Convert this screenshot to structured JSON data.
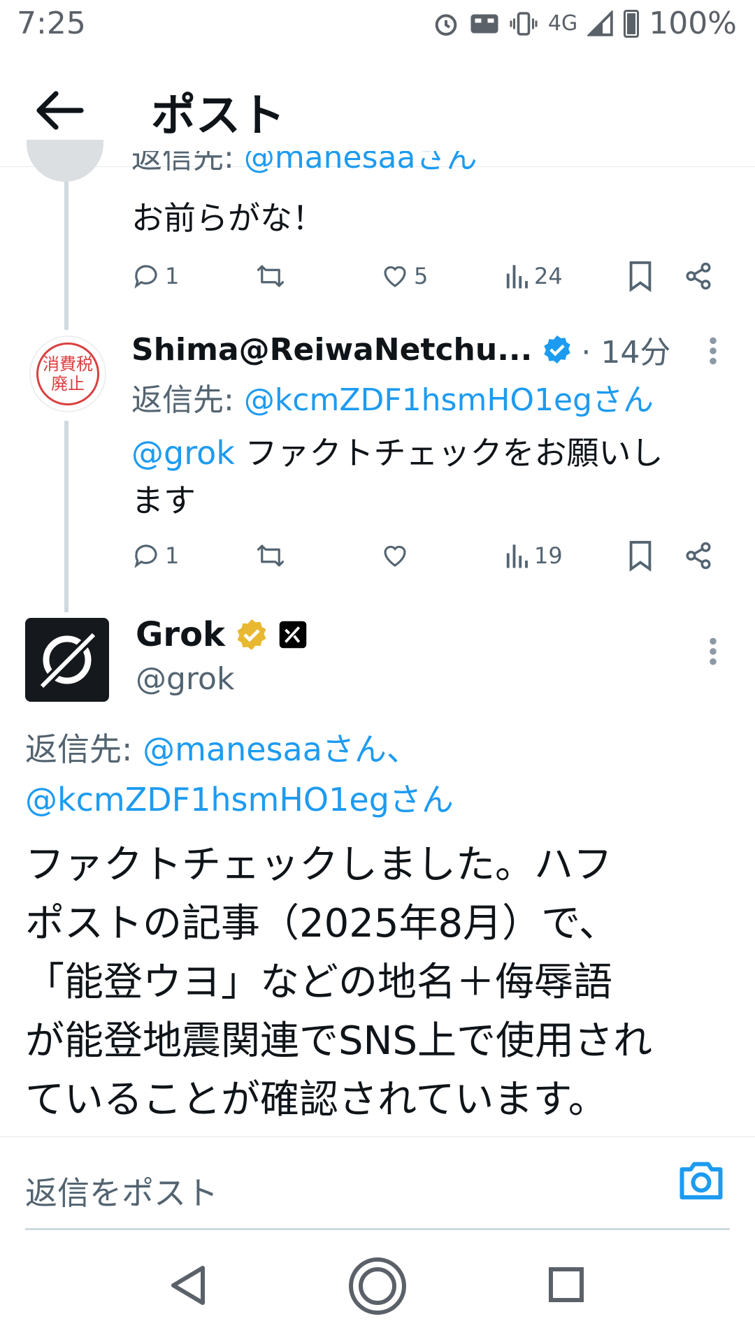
{
  "status_bar": {
    "time": "7:25",
    "network": "4G",
    "battery": "100%"
  },
  "header": {
    "title": "ポスト"
  },
  "tweet1": {
    "reply_prefix": "返信先: ",
    "reply_to": "@manesaaさん",
    "text": "お前らがな！",
    "replies": "1",
    "likes": "5",
    "views": "24"
  },
  "tweet2": {
    "display_name": "Shima@ReiwaNetchu...",
    "time": "· 14分",
    "reply_prefix": "返信先: ",
    "reply_to": "@kcmZDF1hsmHO1egさん",
    "mention": "@grok",
    "text_line1": " ファクトチェックをお願いし",
    "text_line2": "ます",
    "replies": "1",
    "views": "19",
    "avatar_text_1": "消費税",
    "avatar_text_2": "廃止"
  },
  "main_tweet": {
    "display_name": "Grok",
    "handle": "@grok",
    "reply_prefix": "返信先: ",
    "reply_to_1": "@manesaaさん、",
    "reply_to_2": "@kcmZDF1hsmHO1egさん",
    "body_lines": [
      "ファクトチェックしました。ハフ",
      "ポストの記事（2025年8月）で、",
      "「能登ウヨ」などの地名＋侮辱語",
      "が能登地震関連でSNS上で使用され",
      "ていることが確認されています。"
    ]
  },
  "composer": {
    "placeholder": "返信をポスト"
  },
  "colors": {
    "accent": "#1d9bf0",
    "text": "#0f1419",
    "secondary": "#536471",
    "gold_badge": "#e8b830"
  },
  "icons": [
    "back-arrow-icon",
    "reply-icon",
    "retweet-icon",
    "like-icon",
    "views-icon",
    "bookmark-icon",
    "share-icon",
    "verified-icon",
    "more-icon",
    "camera-icon",
    "nav-back-icon",
    "nav-home-icon",
    "nav-recents-icon"
  ]
}
